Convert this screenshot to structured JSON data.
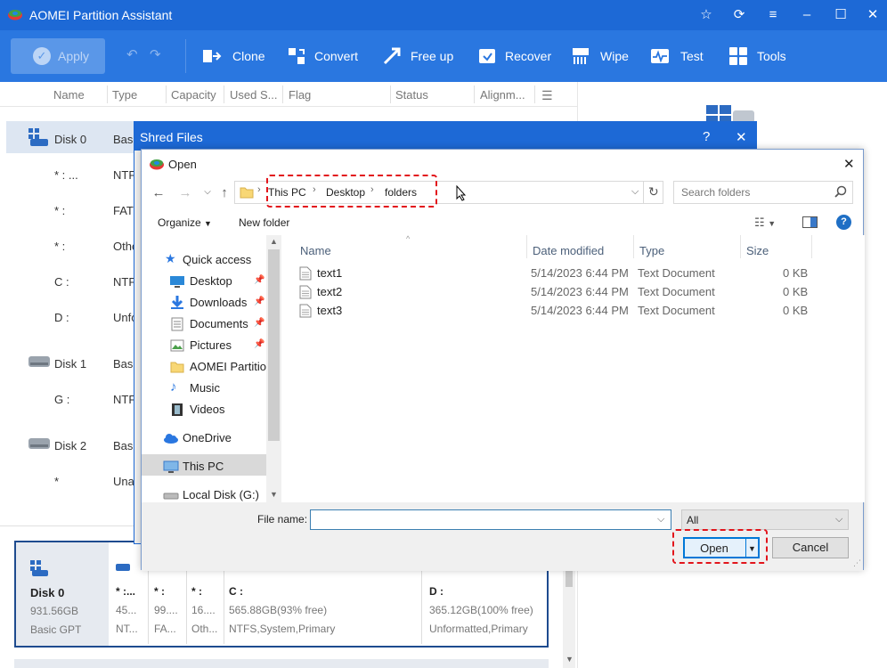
{
  "app": {
    "title": "AOMEI Partition Assistant",
    "toolbar": {
      "apply": "Apply",
      "tools": [
        "Clone",
        "Convert",
        "Free up",
        "Recover",
        "Wipe",
        "Test",
        "Tools"
      ]
    },
    "columns": [
      "Name",
      "Type",
      "Capacity",
      "Used S...",
      "Flag",
      "Status",
      "Alignm..."
    ],
    "rows": [
      {
        "name": "Disk 0",
        "type": "Basi"
      },
      {
        "name": "* : ...",
        "type": "NTF"
      },
      {
        "name": "* :",
        "type": "FAT"
      },
      {
        "name": "* :",
        "type": "Othe"
      },
      {
        "name": "C :",
        "type": "NTF"
      },
      {
        "name": "D :",
        "type": "Unfo"
      },
      {
        "name": "Disk 1",
        "type": "Basi"
      },
      {
        "name": "G :",
        "type": "NTF"
      },
      {
        "name": "Disk 2",
        "type": "Basi"
      },
      {
        "name": "*",
        "type": "Una"
      }
    ],
    "diskmap": {
      "disk": {
        "name": "Disk 0",
        "size": "931.56GB",
        "style": "Basic GPT"
      },
      "partitions": [
        {
          "label": "* :...",
          "size": "45...",
          "fs": "NT..."
        },
        {
          "label": "* :",
          "size": "99....",
          "fs": "FA..."
        },
        {
          "label": "* :",
          "size": "16....",
          "fs": "Oth..."
        },
        {
          "label": "C :",
          "size": "565.88GB(93% free)",
          "fs": "NTFS,System,Primary"
        },
        {
          "label": "D :",
          "size": "365.12GB(100% free)",
          "fs": "Unformatted,Primary"
        }
      ]
    }
  },
  "shred_dialog": {
    "title": "Shred Files",
    "help": "?",
    "close": "✕"
  },
  "open_dialog": {
    "title": "Open",
    "breadcrumb": [
      "This PC",
      "Desktop",
      "folders"
    ],
    "search_placeholder": "Search folders",
    "organize": "Organize",
    "new_folder": "New folder",
    "nav": [
      {
        "label": "Quick access"
      },
      {
        "label": "Desktop",
        "pinned": true
      },
      {
        "label": "Downloads",
        "pinned": true
      },
      {
        "label": "Documents",
        "pinned": true
      },
      {
        "label": "Pictures",
        "pinned": true
      },
      {
        "label": "AOMEI Partition"
      },
      {
        "label": "Music"
      },
      {
        "label": "Videos"
      },
      {
        "label": "OneDrive"
      },
      {
        "label": "This PC"
      },
      {
        "label": "Local Disk (G:)"
      }
    ],
    "file_columns": [
      "Name",
      "Date modified",
      "Type",
      "Size"
    ],
    "files": [
      {
        "name": "text1",
        "date": "5/14/2023 6:44 PM",
        "type": "Text Document",
        "size": "0 KB"
      },
      {
        "name": "text2",
        "date": "5/14/2023 6:44 PM",
        "type": "Text Document",
        "size": "0 KB"
      },
      {
        "name": "text3",
        "date": "5/14/2023 6:44 PM",
        "type": "Text Document",
        "size": "0 KB"
      }
    ],
    "file_name_label": "File name:",
    "file_name_value": "",
    "file_type": "All",
    "open_button": "Open",
    "cancel_button": "Cancel"
  },
  "colors": {
    "titlebar": "#1d69d6",
    "toolbar": "#2a77e0",
    "highlight": "#e2141b"
  }
}
